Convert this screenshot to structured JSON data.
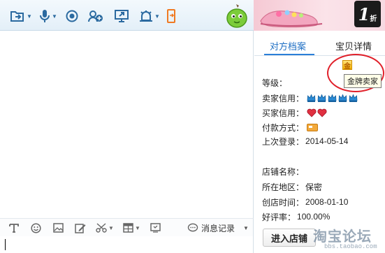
{
  "toolbar": {
    "icons": [
      "send-file-icon",
      "microphone-icon",
      "camera-icon",
      "add-contact-icon",
      "screen-share-icon",
      "alarm-icon",
      "phone-icon"
    ]
  },
  "ad": {
    "badge_number": "1",
    "badge_suffix": "折"
  },
  "panel": {
    "tabs": [
      {
        "label": "对方档案",
        "active": true
      },
      {
        "label": "宝贝详情",
        "active": false
      }
    ],
    "gold_icon_char": "金",
    "tooltip": "金牌卖家",
    "rows": {
      "level": {
        "label": "等级："
      },
      "seller_credit": {
        "label": "卖家信用：",
        "crowns": 5
      },
      "buyer_credit": {
        "label": "买家信用：",
        "hearts": 2
      },
      "payment": {
        "label": "付款方式："
      },
      "last_login": {
        "label": "上次登录：",
        "value": "2014-05-14"
      },
      "shop_name": {
        "label": "店铺名称："
      },
      "region": {
        "label": "所在地区：",
        "value": "保密"
      },
      "created": {
        "label": "创店时间：",
        "value": "2008-01-10"
      },
      "rating": {
        "label": "好评率：",
        "value": "100.00%"
      }
    },
    "enter_shop": "进入店铺"
  },
  "chat_toolbar": {
    "message_record": "消息记录"
  },
  "watermark": {
    "main": "淘宝论坛",
    "sub": "bbs.taobao.com"
  },
  "colors": {
    "accent": "#1f6fc4",
    "toolbar_icon": "#2b6aa0",
    "ellipse": "#e0202a",
    "crown": "#2a8ad4",
    "heart": "#e03040"
  }
}
